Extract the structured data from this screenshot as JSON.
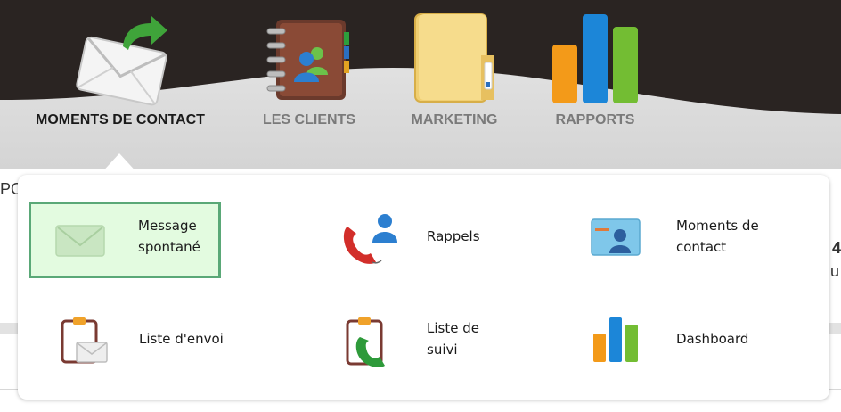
{
  "nav": {
    "tabs": [
      {
        "label": "MOMENTS DE CONTACT",
        "icon": "envelope-arrow-icon",
        "active": true
      },
      {
        "label": "LES CLIENTS",
        "icon": "address-book-icon",
        "active": false
      },
      {
        "label": "MARKETING",
        "icon": "folder-icon",
        "active": false
      },
      {
        "label": "RAPPORTS",
        "icon": "bar-chart-icon",
        "active": false
      }
    ]
  },
  "background": {
    "left_fragment": "PO",
    "right_fragment_1": "4",
    "right_fragment_2": "u"
  },
  "menu": {
    "items": [
      {
        "label_line1": "Message",
        "label_line2": "spontané",
        "icon": "envelope-icon",
        "selected": true
      },
      {
        "label_line1": "Rappels",
        "label_line2": "",
        "icon": "phone-person-icon",
        "selected": false
      },
      {
        "label_line1": "Moments de",
        "label_line2": "contact",
        "icon": "contact-card-icon",
        "selected": false
      },
      {
        "label_line1": "Liste d'envoi",
        "label_line2": "",
        "icon": "clipboard-envelope-icon",
        "selected": false
      },
      {
        "label_line1": "Liste de",
        "label_line2": "suivi",
        "icon": "clipboard-phone-icon",
        "selected": false
      },
      {
        "label_line1": "Dashboard",
        "label_line2": "",
        "icon": "bar-chart-icon",
        "selected": false
      }
    ]
  },
  "colors": {
    "header_dark": "#2a2422",
    "header_light": "#d9d9d9",
    "selected_bg": "#e3fbe0",
    "selected_border": "#5aa877",
    "active_label": "#1a1a1a",
    "inactive_label": "#7a7a7a"
  }
}
